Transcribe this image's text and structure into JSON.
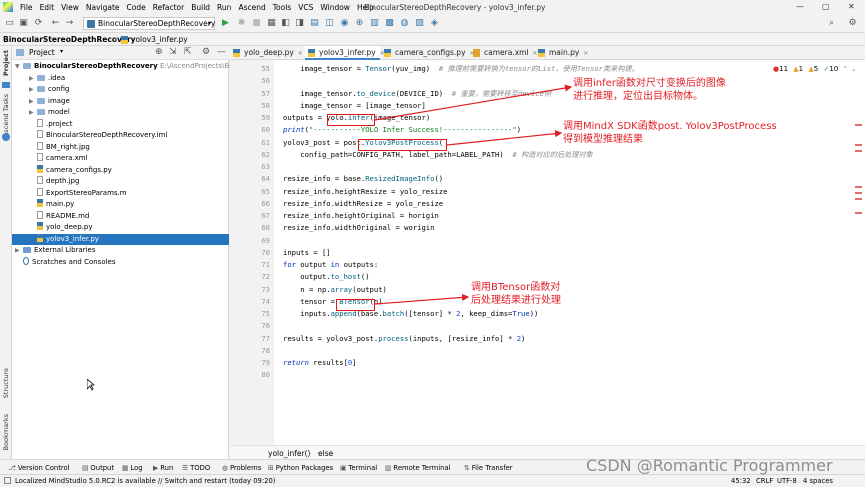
{
  "menu": [
    "File",
    "Edit",
    "View",
    "Navigate",
    "Code",
    "Refactor",
    "Build",
    "Run",
    "Ascend",
    "Tools",
    "VCS",
    "Window",
    "Help"
  ],
  "window_title": "BinocularStereoDepthRecovery - yolov3_infer.py",
  "run_config": "BinocularStereoDepthRecovery",
  "nav": {
    "project": "BinocularStereoDepthRecovery",
    "file": "yolov3_infer.py"
  },
  "left_strip": {
    "project": "Project",
    "ascend_tasks": "Ascend Tasks",
    "structure": "Structure",
    "bookmarks": "Bookmarks"
  },
  "project_panel": {
    "title": "Project",
    "items": [
      {
        "label": "BinocularStereoDepthRecovery",
        "path": "E:\\AscendProjects\\Binocu",
        "type": "root"
      },
      {
        "label": ".idea",
        "type": "folder"
      },
      {
        "label": "config",
        "type": "folder"
      },
      {
        "label": "image",
        "type": "folder"
      },
      {
        "label": "model",
        "type": "folder"
      },
      {
        "label": ".project",
        "type": "file"
      },
      {
        "label": "BinocularStereoDepthRecovery.iml",
        "type": "file"
      },
      {
        "label": "BM_right.jpg",
        "type": "file"
      },
      {
        "label": "camera.xml",
        "type": "file"
      },
      {
        "label": "camera_configs.py",
        "type": "py"
      },
      {
        "label": "depth.jpg",
        "type": "file"
      },
      {
        "label": "ExportStereoParams.m",
        "type": "file"
      },
      {
        "label": "main.py",
        "type": "py"
      },
      {
        "label": "README.md",
        "type": "file"
      },
      {
        "label": "yolo_deep.py",
        "type": "py"
      },
      {
        "label": "yolov3_infer.py",
        "type": "py",
        "selected": true
      },
      {
        "label": "External Libraries",
        "type": "lib"
      },
      {
        "label": "Scratches and Consoles",
        "type": "scratch"
      }
    ]
  },
  "tabs": [
    "yolo_deep.py",
    "yolov3_infer.py",
    "camera_configs.py",
    "camera.xml",
    "main.py"
  ],
  "inspections": {
    "errors": "11",
    "warnings": "1",
    "weak": "5",
    "typos": "10"
  },
  "code_lines": [
    {
      "n": "55",
      "html": "    image_tensor = <span class='fn'>Tensor</span>(yuv_img)  <span class='cm'># 推理前需要转换为tensor的List，使用Tensor类来构建。</span>"
    },
    {
      "n": "56",
      "html": ""
    },
    {
      "n": "57",
      "html": "    image_tensor.<span class='fn'>to_device</span>(DEVICE_ID)  <span class='cm'># 重要，需要转移至device侧</span>"
    },
    {
      "n": "58",
      "html": "    image_tensor = [image_tensor]"
    },
    {
      "n": "59",
      "html": "outputs = yolo.<span class='fn'>infer</span>(image_tensor)"
    },
    {
      "n": "60",
      "html": "<span class='kwi'>print</span>(<span class='st'>\"-----------YOLO Infer Success!----------------\"</span>)"
    },
    {
      "n": "61",
      "html": "yolov3_post = post.<span class='fn'>Yolov3PostProcess</span>("
    },
    {
      "n": "62",
      "html": "    config_path=CONFIG_PATH, label_path=LABEL_PATH)  <span class='cm'># 构造对应的后处理对象</span>"
    },
    {
      "n": "63",
      "html": ""
    },
    {
      "n": "64",
      "html": "resize_info = base.<span class='fn'>ResizedImageInfo</span>()"
    },
    {
      "n": "65",
      "html": "resize_info.heightResize = yolo_resize"
    },
    {
      "n": "66",
      "html": "resize_info.widthResize = yolo_resize"
    },
    {
      "n": "67",
      "html": "resize_info.heightOriginal = horigin"
    },
    {
      "n": "68",
      "html": "resize_info.widthOriginal = worigin"
    },
    {
      "n": "69",
      "html": ""
    },
    {
      "n": "70",
      "html": "inputs = []"
    },
    {
      "n": "71",
      "html": "<span class='kw'>for</span> output <span class='kw'>in</span> outputs:"
    },
    {
      "n": "72",
      "html": "    output.<span class='fn'>to_host</span>()"
    },
    {
      "n": "73",
      "html": "    n = np.<span class='fn'>array</span>(output)"
    },
    {
      "n": "74",
      "html": "    tensor = <span class='fn'>BTensor</span>(n)"
    },
    {
      "n": "75",
      "html": "    inputs.<span class='fn'>append</span>(base.<span class='fn'>batch</span>([tensor] * <span class='nm'>2</span>, keep_dims=<span class='kw'>True</span>))"
    },
    {
      "n": "76",
      "html": ""
    },
    {
      "n": "77",
      "html": "results = yolov3_post.<span class='fn'>process</span>(inputs, [resize_info] * <span class='nm'>2</span>)"
    },
    {
      "n": "78",
      "html": ""
    },
    {
      "n": "79",
      "html": "<span class='kwi'>return</span> results[<span class='nm'>0</span>]"
    },
    {
      "n": "80",
      "html": ""
    }
  ],
  "annotations": {
    "infer_line1": "调用infer函数对尺寸变换后的图像",
    "infer_line2": "进行推理，定位出目标物体。",
    "post_line1": "调用MindX SDK函数post. Yolov3PostProcess",
    "post_line2": "得到模型推理结果",
    "btensor_line1": "调用BTensor函数对",
    "btensor_line2": "后处理结果进行处理"
  },
  "breadcrumb": {
    "fn": "yolo_infer()",
    "branch": "else"
  },
  "bottom_tools": [
    "Version Control",
    "Output",
    "Log",
    "Run",
    "TODO",
    "Problems",
    "Python Packages",
    "Terminal",
    "Remote Terminal",
    "File Transfer"
  ],
  "status": {
    "message": "Localized MindStudio 5.0.RC2 is available // Switch and restart (today 09:20)",
    "position": "45:32",
    "line_sep": "CRLF",
    "encoding": "UTF-8",
    "indent": "4 spaces"
  },
  "watermark": "CSDN @Romantic Programmer",
  "colors": {
    "accent": "#2675bf",
    "annotation": "#e01e24"
  }
}
